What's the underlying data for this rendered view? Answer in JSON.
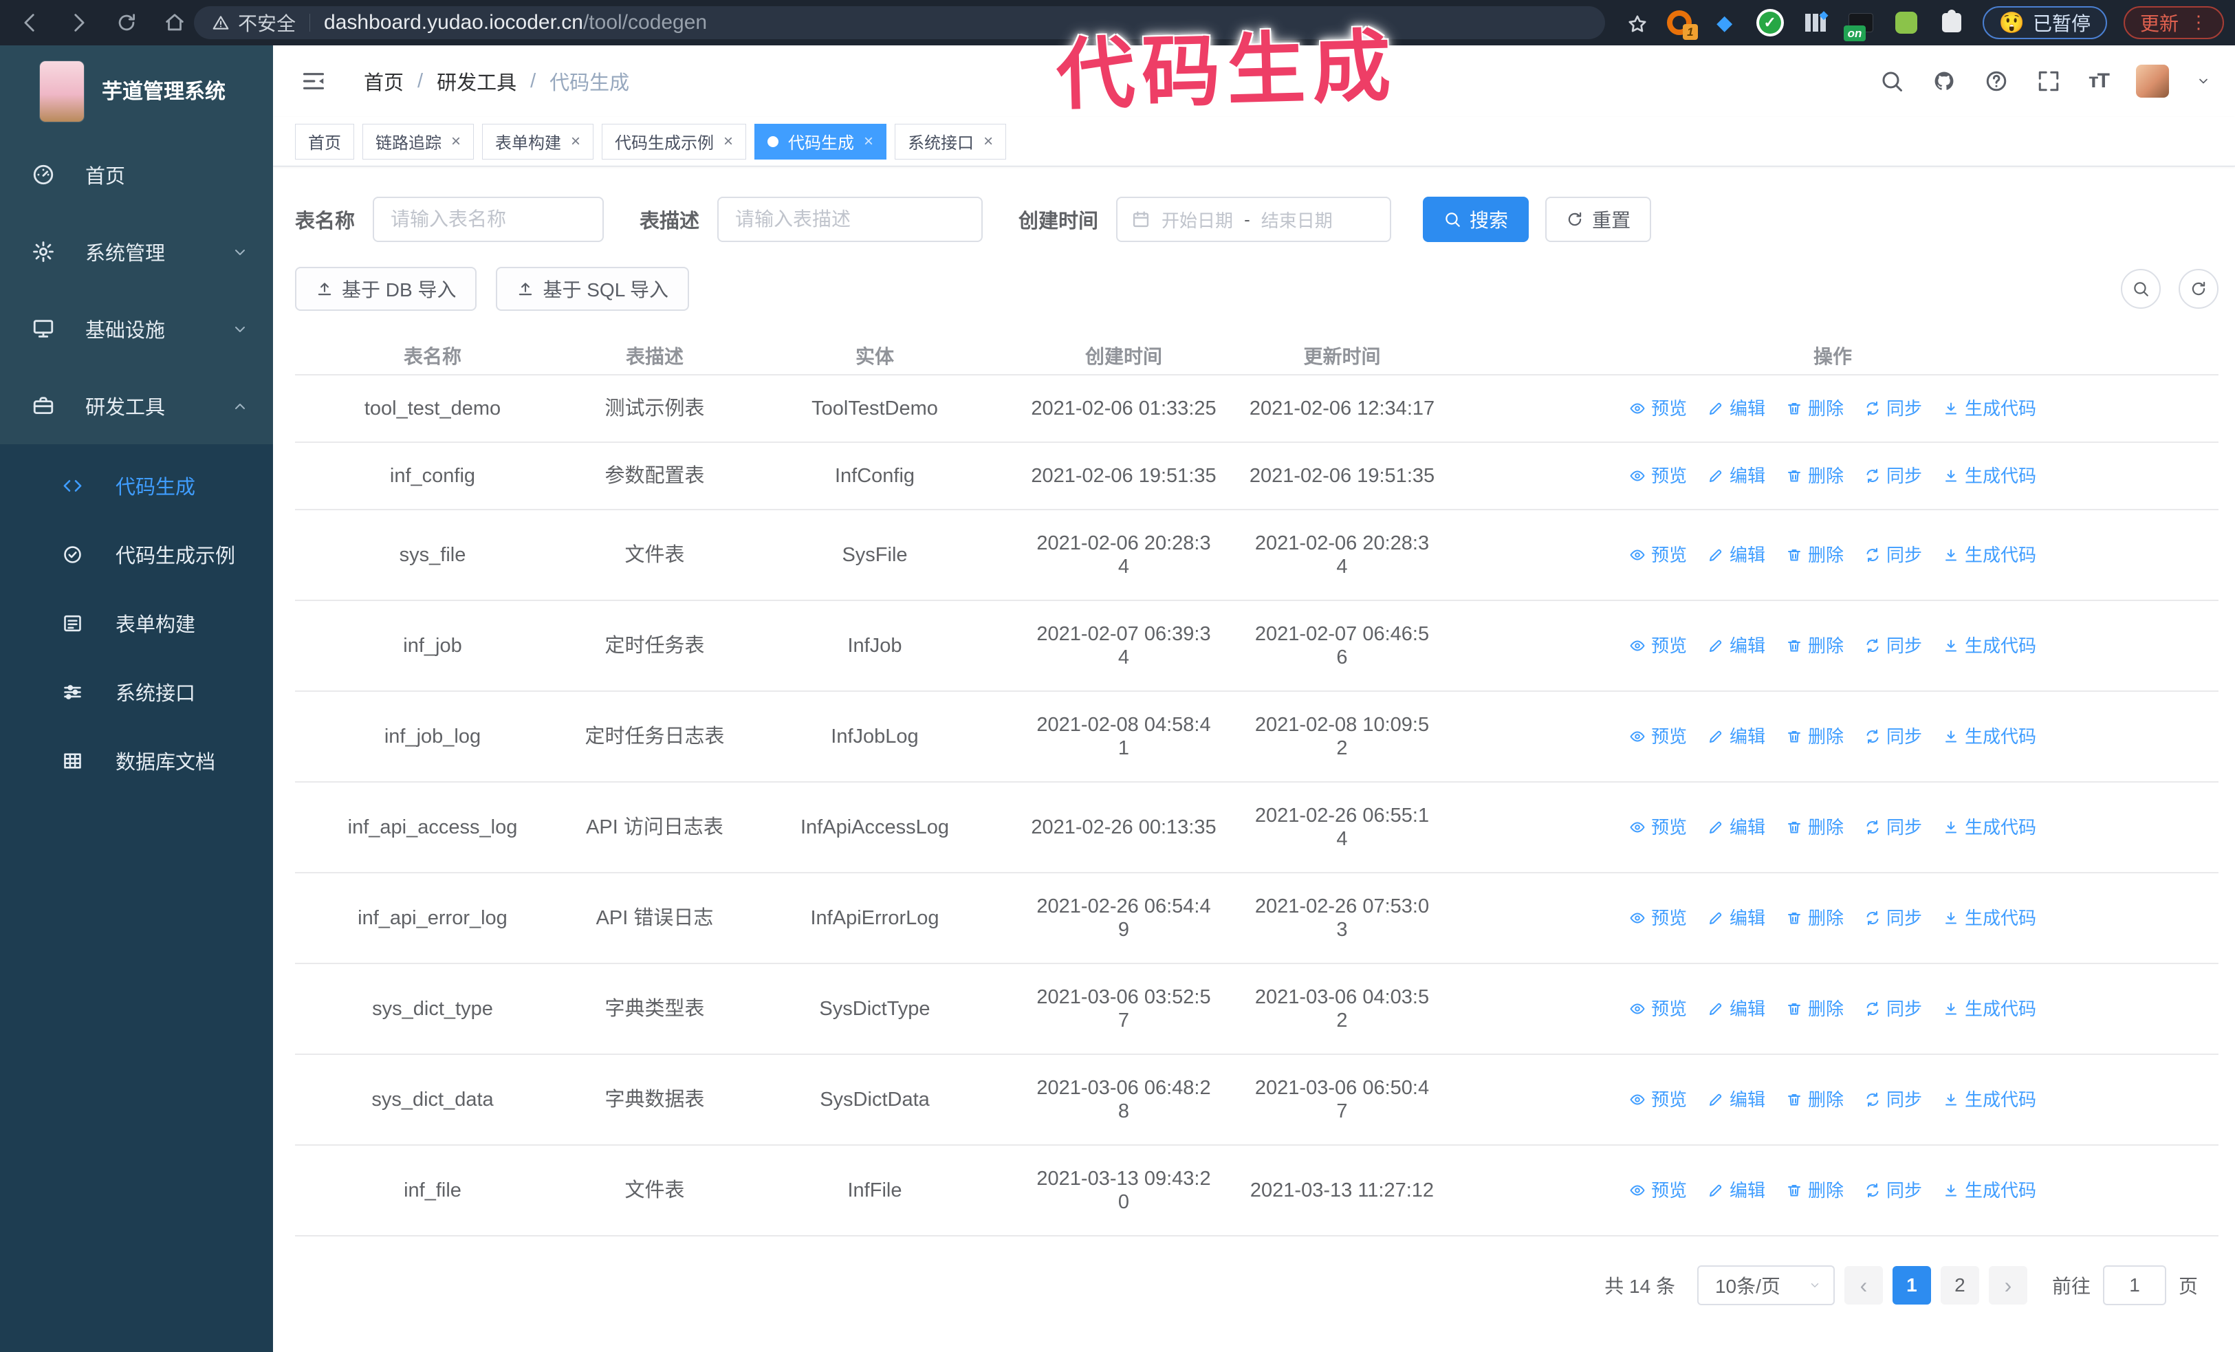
{
  "browser": {
    "security_label": "不安全",
    "url_domain": "dashboard.yudao.iocoder.cn",
    "url_path": "/tool/codegen",
    "extensions": [
      {
        "name": "ext-orange-circle",
        "badge": "1"
      },
      {
        "name": "ext-blue-gem",
        "badge": ""
      },
      {
        "name": "ext-green-check",
        "badge": ""
      },
      {
        "name": "ext-panels",
        "badge": ""
      },
      {
        "name": "ext-dark",
        "badge": "on"
      },
      {
        "name": "ext-green-bot",
        "badge": ""
      },
      {
        "name": "ext-puzzle",
        "badge": ""
      }
    ],
    "paused": {
      "emoji": "😲",
      "label": "已暂停"
    },
    "update": {
      "label": "更新"
    }
  },
  "annotation": {
    "text": "代码生成",
    "color": "#ee3e66"
  },
  "sidebar": {
    "title": "芋道管理系统",
    "items": [
      {
        "key": "home",
        "icon": "dashboard-icon",
        "label": "首页",
        "chevron": ""
      },
      {
        "key": "system",
        "icon": "gear-icon",
        "label": "系统管理",
        "chevron": "down"
      },
      {
        "key": "infra",
        "icon": "monitor-icon",
        "label": "基础设施",
        "chevron": "down"
      },
      {
        "key": "devtools",
        "icon": "toolbox-icon",
        "label": "研发工具",
        "chevron": "up"
      }
    ],
    "subitems": [
      {
        "key": "codegen",
        "icon": "code-icon",
        "label": "代码生成",
        "active": true
      },
      {
        "key": "codegen-demo",
        "icon": "badge-check-icon",
        "label": "代码生成示例",
        "active": false
      },
      {
        "key": "form-builder",
        "icon": "form-icon",
        "label": "表单构建",
        "active": false
      },
      {
        "key": "system-api",
        "icon": "sliders-icon",
        "label": "系统接口",
        "active": false
      },
      {
        "key": "db-doc",
        "icon": "database-icon",
        "label": "数据库文档",
        "active": false
      }
    ]
  },
  "header": {
    "breadcrumb": [
      {
        "label": "首页",
        "current": false
      },
      {
        "label": "研发工具",
        "current": false
      },
      {
        "label": "代码生成",
        "current": true
      }
    ]
  },
  "tabs": [
    {
      "label": "首页",
      "closable": false,
      "active": false
    },
    {
      "label": "链路追踪",
      "closable": true,
      "active": false
    },
    {
      "label": "表单构建",
      "closable": true,
      "active": false
    },
    {
      "label": "代码生成示例",
      "closable": true,
      "active": false
    },
    {
      "label": "代码生成",
      "closable": true,
      "active": true
    },
    {
      "label": "系统接口",
      "closable": true,
      "active": false
    }
  ],
  "filters": {
    "table_name_label": "表名称",
    "table_name_placeholder": "请输入表名称",
    "table_desc_label": "表描述",
    "table_desc_placeholder": "请输入表描述",
    "create_time_label": "创建时间",
    "date_start_placeholder": "开始日期",
    "date_separator": "-",
    "date_end_placeholder": "结束日期",
    "search_label": "搜索",
    "reset_label": "重置"
  },
  "toolbar": {
    "import_db_label": "基于 DB 导入",
    "import_sql_label": "基于 SQL 导入"
  },
  "table": {
    "columns": [
      "表名称",
      "表描述",
      "实体",
      "创建时间",
      "更新时间",
      "操作"
    ],
    "actions": [
      {
        "icon": "eye-icon",
        "label": "预览"
      },
      {
        "icon": "edit-icon",
        "label": "编辑"
      },
      {
        "icon": "delete-icon",
        "label": "删除"
      },
      {
        "icon": "sync-icon",
        "label": "同步"
      },
      {
        "icon": "download-icon",
        "label": "生成代码"
      }
    ],
    "rows": [
      {
        "name": "tool_test_demo",
        "desc": "测试示例表",
        "entity": "ToolTestDemo",
        "created": "2021-02-06 01:33:25",
        "updated": "2021-02-06 12:34:17"
      },
      {
        "name": "inf_config",
        "desc": "参数配置表",
        "entity": "InfConfig",
        "created": "2021-02-06 19:51:35",
        "updated": "2021-02-06 19:51:35"
      },
      {
        "name": "sys_file",
        "desc": "文件表",
        "entity": "SysFile",
        "created": "2021-02-06 20:28:3\n4",
        "updated": "2021-02-06 20:28:3\n4"
      },
      {
        "name": "inf_job",
        "desc": "定时任务表",
        "entity": "InfJob",
        "created": "2021-02-07 06:39:3\n4",
        "updated": "2021-02-07 06:46:5\n6"
      },
      {
        "name": "inf_job_log",
        "desc": "定时任务日志表",
        "entity": "InfJobLog",
        "created": "2021-02-08 04:58:4\n1",
        "updated": "2021-02-08 10:09:5\n2"
      },
      {
        "name": "inf_api_access_log",
        "desc": "API 访问日志表",
        "entity": "InfApiAccessLog",
        "created": "2021-02-26 00:13:35",
        "updated": "2021-02-26 06:55:1\n4"
      },
      {
        "name": "inf_api_error_log",
        "desc": "API 错误日志",
        "entity": "InfApiErrorLog",
        "created": "2021-02-26 06:54:4\n9",
        "updated": "2021-02-26 07:53:0\n3"
      },
      {
        "name": "sys_dict_type",
        "desc": "字典类型表",
        "entity": "SysDictType",
        "created": "2021-03-06 03:52:5\n7",
        "updated": "2021-03-06 04:03:5\n2"
      },
      {
        "name": "sys_dict_data",
        "desc": "字典数据表",
        "entity": "SysDictData",
        "created": "2021-03-06 06:48:2\n8",
        "updated": "2021-03-06 06:50:4\n7"
      },
      {
        "name": "inf_file",
        "desc": "文件表",
        "entity": "InfFile",
        "created": "2021-03-13 09:43:2\n0",
        "updated": "2021-03-13 11:27:12"
      }
    ]
  },
  "pagination": {
    "total": "共 14 条",
    "page_size": "10条/页",
    "pages": [
      "1",
      "2"
    ],
    "active_page": "1",
    "goto_label": "前往",
    "goto_value": "1",
    "goto_unit": "页"
  },
  "colors": {
    "accent": "#409eff",
    "primary_button": "#2d8cf0",
    "annotation": "#ee3e66",
    "sidebar_bg": "#2b4a5a",
    "submenu_bg": "#1e3d51",
    "chrome_bg": "#1d2530"
  }
}
